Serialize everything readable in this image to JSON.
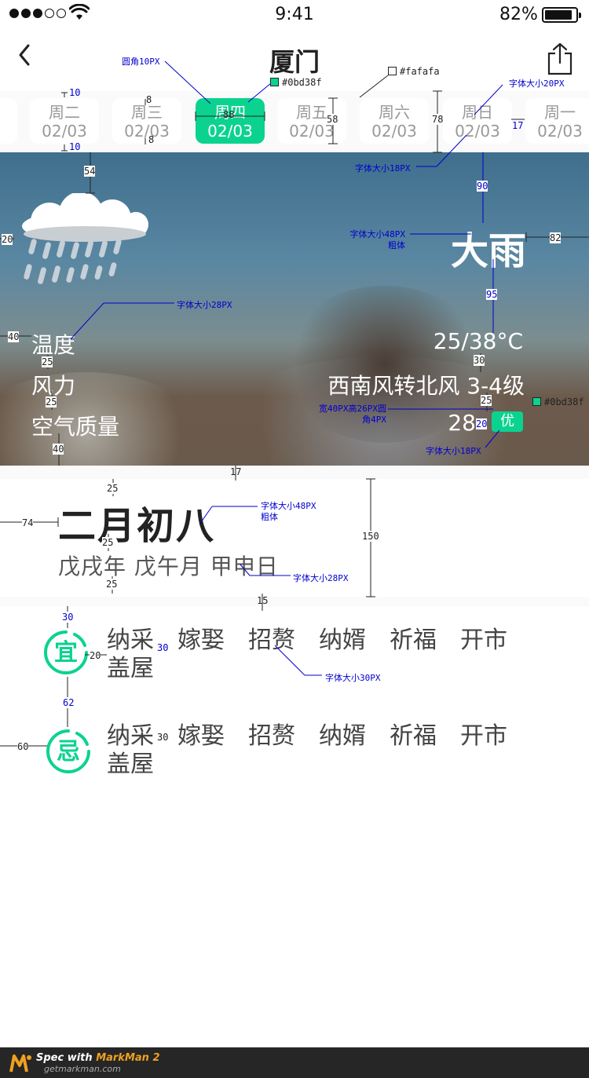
{
  "status_bar": {
    "time": "9:41",
    "battery": "82%"
  },
  "header": {
    "title": "厦门"
  },
  "days": [
    {
      "weekday": "周二",
      "date": "02/03",
      "active": false
    },
    {
      "weekday": "周三",
      "date": "02/03",
      "active": false
    },
    {
      "weekday": "周四",
      "date": "02/03",
      "active": true
    },
    {
      "weekday": "周五",
      "date": "02/03",
      "active": false
    },
    {
      "weekday": "周六",
      "date": "02/03",
      "active": false
    },
    {
      "weekday": "周日",
      "date": "02/03",
      "active": false
    },
    {
      "weekday": "周一",
      "date": "02/03",
      "active": false
    }
  ],
  "weather": {
    "condition": "大雨",
    "temp_label": "温度",
    "temp_value": "25/38°C",
    "wind_label": "风力",
    "wind_value": "西南风转北风 3-4级",
    "aqi_label": "空气质量",
    "aqi_value": "28",
    "aqi_level": "优"
  },
  "lunar": {
    "date": "二月初八",
    "ganzhi": "戊戌年 戊午月 甲申日"
  },
  "yi": {
    "seal": "宜",
    "items": [
      "纳采",
      "嫁娶",
      "招赘",
      "纳婿",
      "祈福",
      "开市",
      "盖屋"
    ]
  },
  "ji": {
    "seal": "忌",
    "items": [
      "纳采",
      "嫁娶",
      "招赘",
      "纳婿",
      "祈福",
      "开市",
      "盖屋"
    ]
  },
  "colors": {
    "accent": "#0bd38f",
    "strip_bg": "#fafafa"
  },
  "annotations": {
    "corner": "圆角10PX",
    "accent": "#0bd38f",
    "strip": "#fafafa",
    "font20": "字体大小20PX",
    "font18a": "字体大小18PX",
    "font48a": "字体大小48PX",
    "bold1": "粗体",
    "font28a": "字体大小28PX",
    "badge1": "宽40PX高26PX圆",
    "badge2": "角4PX",
    "accent2": "#0bd38f",
    "font18b": "字体大小18PX",
    "font48b": "字体大小48PX",
    "bold2": "粗体",
    "font28b": "字体大小28PX",
    "font30": "字体大小30PX",
    "nums": {
      "n10a": "10",
      "n8a": "8",
      "n88": "88",
      "n58": "58",
      "n78": "78",
      "n17a": "17",
      "n10b": "10",
      "n8b": "8",
      "n54": "54",
      "n90": "90",
      "n20a": "20",
      "n82": "82",
      "n95": "95",
      "n40a": "40",
      "n25a": "25",
      "n30a": "30",
      "n25b": "25",
      "n25c": "25",
      "n20b": "20",
      "n40b": "40",
      "n17b": "17",
      "n25d": "25",
      "n74": "74",
      "n150": "150",
      "n25e": "25",
      "n25f": "25",
      "n15": "15",
      "n30b": "30",
      "n20c": "20",
      "n30c": "30",
      "n62": "62",
      "n60": "60",
      "n30d": "30"
    }
  },
  "footer": {
    "brand": "Spec with",
    "product": "MarkMan 2",
    "url": "getmarkman.com"
  }
}
